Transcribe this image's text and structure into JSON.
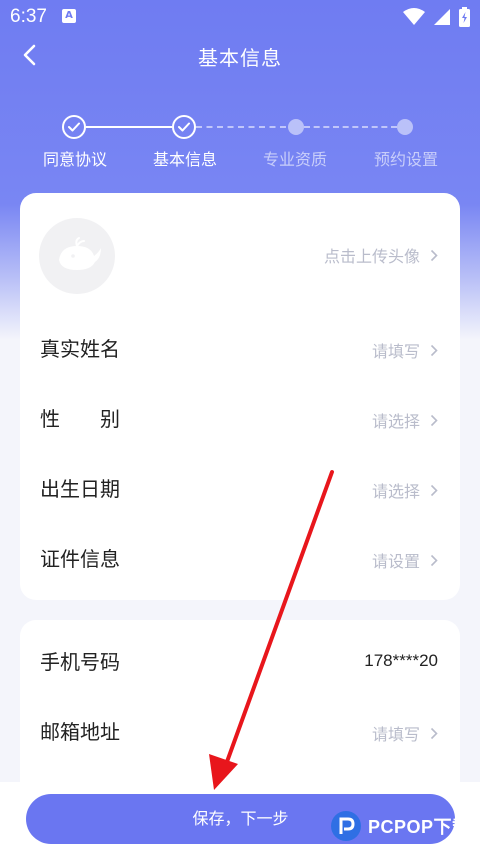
{
  "status_bar": {
    "time": "6:37",
    "notification_icon": "a-notification-icon",
    "icons": [
      "wifi-icon",
      "signal-icon",
      "battery-icon"
    ]
  },
  "header": {
    "title": "基本信息",
    "back_icon": "back-arrow-icon"
  },
  "steps": [
    {
      "label": "同意协议",
      "state": "done"
    },
    {
      "label": "基本信息",
      "state": "done"
    },
    {
      "label": "专业资质",
      "state": "todo"
    },
    {
      "label": "预约设置",
      "state": "todo"
    }
  ],
  "profile_card": {
    "avatar_icon": "whale-avatar-icon",
    "avatar_hint": "点击上传头像",
    "rows": [
      {
        "label": "真实姓名",
        "value": "请填写"
      },
      {
        "label": "性　　别",
        "value": "请选择"
      },
      {
        "label": "出生日期",
        "value": "请选择"
      },
      {
        "label": "证件信息",
        "value": "请设置"
      }
    ]
  },
  "contact_card": {
    "rows": [
      {
        "label": "手机号码",
        "value": "178****20"
      },
      {
        "label": "邮箱地址",
        "value": "请填写"
      }
    ]
  },
  "footer": {
    "submit_label": "保存，下一步"
  },
  "watermark": {
    "text": "PCPOP下载"
  },
  "colors": {
    "brand": "#6f7cf2",
    "button": "#6a76f1",
    "placeholder": "#b9bccb",
    "annotation": "#e8161c"
  }
}
